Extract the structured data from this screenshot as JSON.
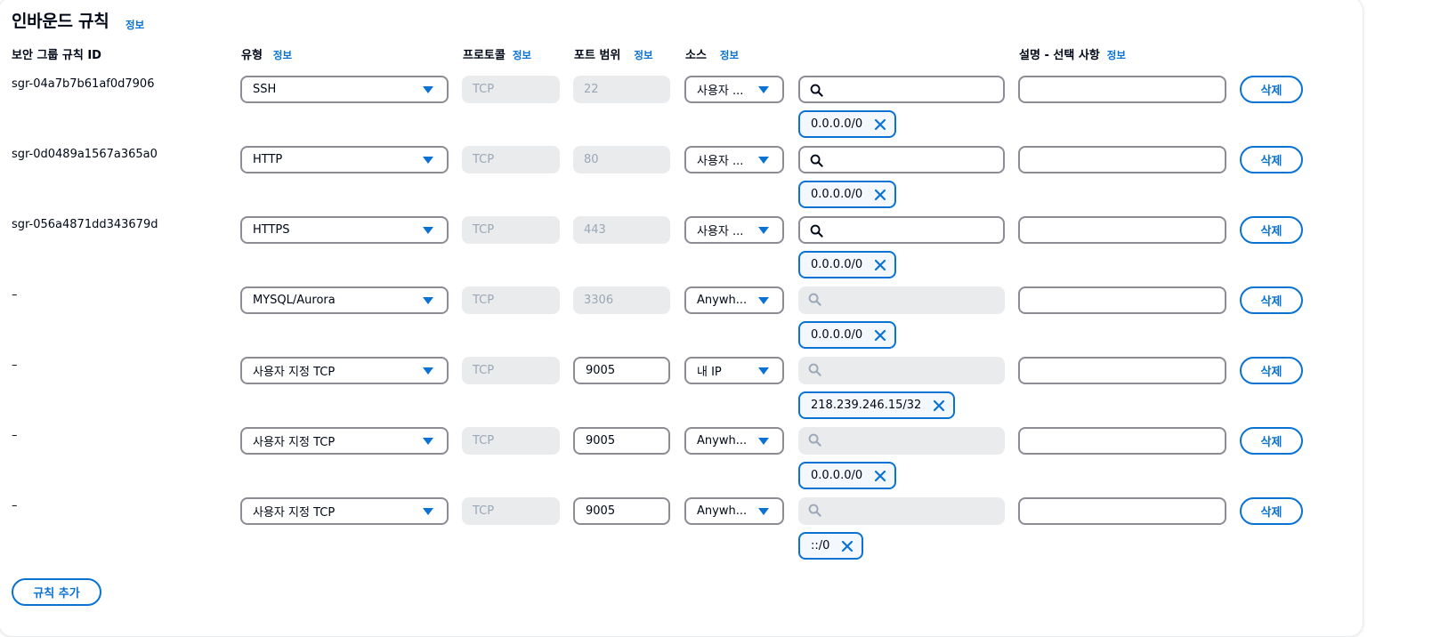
{
  "section": {
    "title": "인바운드 규칙",
    "info_label": "정보"
  },
  "columns": {
    "rule_id": "보안 그룹 규칙 ID",
    "type": "유형",
    "protocol": "프로토콜",
    "port_range": "포트 범위",
    "source": "소스",
    "description": "설명 - 선택 사항",
    "info_label": "정보"
  },
  "rows": [
    {
      "rule_id": "sgr-04a7b7b61af0d7906",
      "type": "SSH",
      "protocol": "TCP",
      "port": "22",
      "port_editable": false,
      "source": "사용자 ...",
      "search_enabled": true,
      "token": "0.0.0.0/0",
      "description": "",
      "delete_label": "삭제"
    },
    {
      "rule_id": "sgr-0d0489a1567a365a0",
      "type": "HTTP",
      "protocol": "TCP",
      "port": "80",
      "port_editable": false,
      "source": "사용자 ...",
      "search_enabled": true,
      "token": "0.0.0.0/0",
      "description": "",
      "delete_label": "삭제"
    },
    {
      "rule_id": "sgr-056a4871dd343679d",
      "type": "HTTPS",
      "protocol": "TCP",
      "port": "443",
      "port_editable": false,
      "source": "사용자 ...",
      "search_enabled": true,
      "token": "0.0.0.0/0",
      "description": "",
      "delete_label": "삭제"
    },
    {
      "rule_id": "–",
      "type": "MYSQL/Aurora",
      "protocol": "TCP",
      "port": "3306",
      "port_editable": false,
      "source": "Anywh...",
      "search_enabled": false,
      "token": "0.0.0.0/0",
      "description": "",
      "delete_label": "삭제"
    },
    {
      "rule_id": "–",
      "type": "사용자 지정 TCP",
      "protocol": "TCP",
      "port": "9005",
      "port_editable": true,
      "source": "내 IP",
      "search_enabled": false,
      "token": "218.239.246.15/32",
      "description": "",
      "delete_label": "삭제"
    },
    {
      "rule_id": "–",
      "type": "사용자 지정 TCP",
      "protocol": "TCP",
      "port": "9005",
      "port_editable": true,
      "source": "Anywh...",
      "search_enabled": false,
      "token": "0.0.0.0/0",
      "description": "",
      "delete_label": "삭제"
    },
    {
      "rule_id": "–",
      "type": "사용자 지정 TCP",
      "protocol": "TCP",
      "port": "9005",
      "port_editable": true,
      "source": "Anywh...",
      "search_enabled": false,
      "token": "::/0",
      "description": "",
      "delete_label": "삭제"
    }
  ],
  "add_rule_label": "규칙 추가",
  "icons": {
    "search": "search-icon",
    "remove": "close-icon",
    "dropdown": "caret-down-icon"
  },
  "colors": {
    "accent": "#0972d3",
    "disabled_bg": "#e9ebed",
    "border": "#8c8c94",
    "token_bg": "#f2f8fd"
  }
}
